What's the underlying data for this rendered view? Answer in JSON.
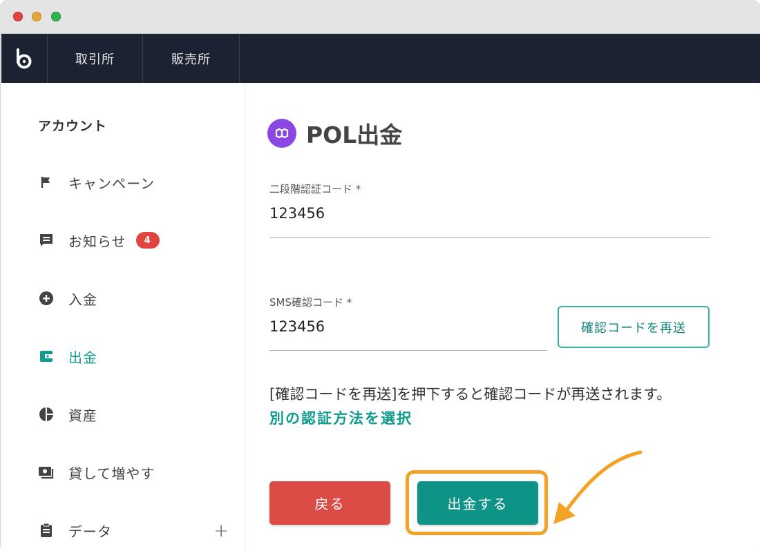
{
  "window": {
    "controls": [
      "close",
      "minimize",
      "maximize"
    ]
  },
  "nav": {
    "logo_icon": "bitbank-logo-icon",
    "tabs": [
      "取引所",
      "販売所"
    ]
  },
  "sidebar": {
    "title": "アカウント",
    "items": [
      {
        "label": "キャンペーン",
        "icon": "flag-icon"
      },
      {
        "label": "お知らせ",
        "icon": "message-icon",
        "badge": "4"
      },
      {
        "label": "入金",
        "icon": "plus-circle-icon"
      },
      {
        "label": "出金",
        "icon": "wallet-icon",
        "active": true
      },
      {
        "label": "資産",
        "icon": "pie-chart-icon"
      },
      {
        "label": "貸して増やす",
        "icon": "lend-icon"
      },
      {
        "label": "データ",
        "icon": "clipboard-icon",
        "expand": "+"
      }
    ]
  },
  "main": {
    "title": "POL出金",
    "coin_icon": "polygon-icon",
    "two_factor": {
      "label": "二段階認証コード *",
      "value": "123456"
    },
    "sms": {
      "label": "SMS確認コード *",
      "value": "123456"
    },
    "resend_button": "確認コードを再送",
    "note": "[確認コードを再送]を押下すると確認コードが再送されます。",
    "alt_link": "別の認証方法を選択",
    "back_button": "戻る",
    "withdraw_button": "出金する"
  },
  "colors": {
    "accent": "#0e9486",
    "danger": "#dc4c47",
    "highlight": "#f2a325",
    "nav_bg": "#1c2231",
    "coin": "#8a48e3"
  }
}
